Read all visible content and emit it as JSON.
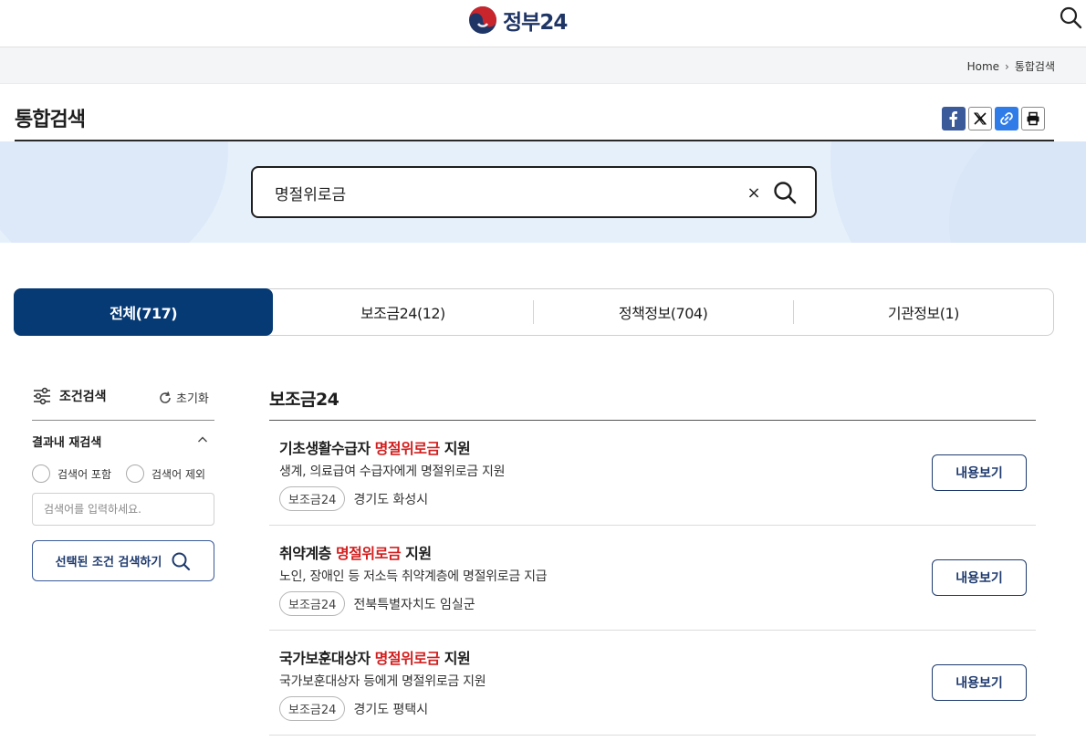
{
  "header": {
    "logo_text": "정부24",
    "search_icon": "search-icon"
  },
  "breadcrumb": {
    "home": "Home",
    "current": "통합검색"
  },
  "page": {
    "title": "통합검색",
    "share_icons": [
      "facebook-icon",
      "x-icon",
      "link-icon",
      "print-icon"
    ]
  },
  "search": {
    "value": "명절위로금",
    "clear_label": "×"
  },
  "tabs": [
    {
      "label": "전체(717)",
      "active": true
    },
    {
      "label": "보조금24(12)",
      "active": false
    },
    {
      "label": "정책정보(704)",
      "active": false
    },
    {
      "label": "기관정보(1)",
      "active": false
    }
  ],
  "filters": {
    "title": "조건검색",
    "reset": "초기화",
    "refine_title": "결과내 재검색",
    "include_label": "검색어 포함",
    "exclude_label": "검색어 제외",
    "input_placeholder": "검색어를 입력하세요.",
    "apply_label": "선택된 조건 검색하기"
  },
  "results": {
    "section_title": "보조금24",
    "view_label": "내용보기",
    "items": [
      {
        "title_pre": "기초생활수급자 ",
        "title_hl": "명절위로금",
        "title_post": " 지원",
        "desc": "생계, 의료급여 수급자에게 명절위로금 지원",
        "badge": "보조금24",
        "region": "경기도 화성시"
      },
      {
        "title_pre": "취약계층 ",
        "title_hl": "명절위로금",
        "title_post": " 지원",
        "desc": "노인, 장애인 등 저소득 취약계층에 명절위로금 지급",
        "badge": "보조금24",
        "region": "전북특별자치도 임실군"
      },
      {
        "title_pre": "국가보훈대상자 ",
        "title_hl": "명절위로금",
        "title_post": " 지원",
        "desc": "국가보훈대상자 등에게 명절위로금 지원",
        "badge": "보조금24",
        "region": "경기도 평택시"
      }
    ]
  },
  "colors": {
    "primary": "#063a74",
    "highlight": "#d21e1e",
    "banner": "#e6f0fb"
  }
}
